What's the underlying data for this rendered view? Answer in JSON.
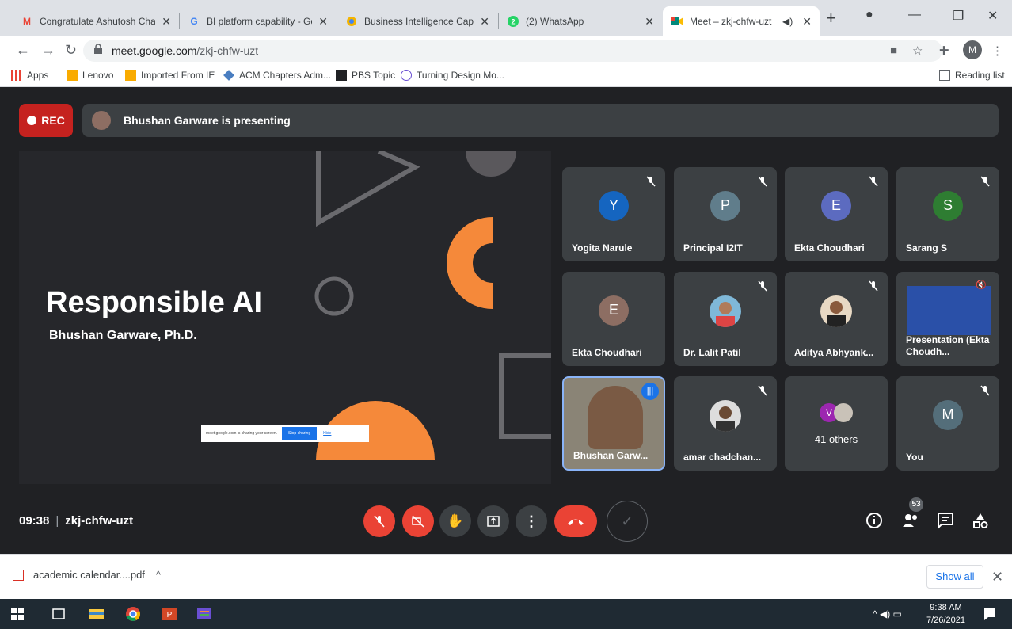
{
  "tabs": [
    {
      "title": "Congratulate Ashutosh Chalm",
      "favicon": "gmail-icon"
    },
    {
      "title": "BI platform capability - Goog",
      "favicon": "google-icon"
    },
    {
      "title": "Business Intelligence Capabili",
      "favicon": "chrome-icon"
    },
    {
      "title": "(2) WhatsApp",
      "favicon": "whatsapp-icon"
    },
    {
      "title": "Meet – zkj-chfw-uzt",
      "favicon": "meet-icon",
      "active": true
    }
  ],
  "address": {
    "host": "meet.google.com",
    "path": "/zkj-chfw-uzt"
  },
  "bookmarks": [
    "Apps",
    "Lenovo",
    "Imported From IE",
    "ACM Chapters Adm...",
    "PBS Topic",
    "Turning Design Mo..."
  ],
  "reading_list": "Reading list",
  "profile_initial": "M",
  "meet": {
    "rec_label": "REC",
    "presenting_text": "Bhushan Garware is presenting",
    "slide": {
      "title": "Responsible AI",
      "subtitle": "Bhushan Garware, Ph.D."
    },
    "share_notice": {
      "text": "meet.google.com is sharing your screen.",
      "stop": "Stop sharing",
      "hide": "Hide"
    },
    "participants": [
      {
        "name": "Yogita Narule",
        "initial": "Y",
        "color": "#1565c0"
      },
      {
        "name": "Principal I2IT",
        "initial": "P",
        "color": "#607d8b"
      },
      {
        "name": "Ekta Choudhari",
        "initial": "E",
        "color": "#5c6bc0"
      },
      {
        "name": "Sarang S",
        "initial": "S",
        "color": "#2e7d32"
      },
      {
        "name": "Ekta Choudhari",
        "initial": "E",
        "color": "#8d6e63"
      },
      {
        "name": "Dr. Lalit Patil"
      },
      {
        "name": "Aditya Abhyank..."
      },
      {
        "name": "Presentation (Ekta Choudh..."
      },
      {
        "name": "Bhushan Garw..."
      },
      {
        "name": "amar chadchan..."
      },
      {
        "name": "41 others",
        "initial": "V"
      },
      {
        "name": "You",
        "initial": "M",
        "color": "#546e7a"
      }
    ],
    "time": "09:38",
    "code": "zkj-chfw-uzt",
    "participant_count": "53"
  },
  "download": {
    "file": "academic calendar....pdf",
    "show_all": "Show all"
  },
  "taskbar": {
    "time": "9:38 AM",
    "date": "7/26/2021"
  }
}
